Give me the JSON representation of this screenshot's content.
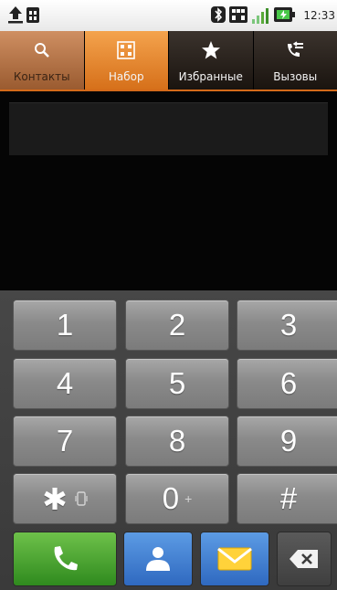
{
  "status_bar": {
    "time": "12:33"
  },
  "tabs": [
    {
      "label": "Контакты",
      "icon": "search-icon",
      "state": "pressed"
    },
    {
      "label": "Набор",
      "icon": "dialpad-icon",
      "state": "active"
    },
    {
      "label": "Избранные",
      "icon": "star-icon",
      "state": "normal"
    },
    {
      "label": "Вызовы",
      "icon": "call-log-icon",
      "state": "normal"
    }
  ],
  "display": {
    "number": ""
  },
  "keypad": {
    "keys": [
      {
        "label": "1"
      },
      {
        "label": "2"
      },
      {
        "label": "3"
      },
      {
        "label": "4"
      },
      {
        "label": "5"
      },
      {
        "label": "6"
      },
      {
        "label": "7"
      },
      {
        "label": "8"
      },
      {
        "label": "9"
      },
      {
        "label": "✱",
        "sub_icon": "vibrate-icon"
      },
      {
        "label": "0",
        "sub": "+"
      },
      {
        "label": "#"
      }
    ]
  },
  "actions": {
    "call": {
      "icon": "phone-icon",
      "color": "#3a9a26"
    },
    "contact": {
      "icon": "person-icon",
      "color": "#3a78cf"
    },
    "message": {
      "icon": "envelope-icon",
      "color": "#3a78cf"
    },
    "delete": {
      "icon": "backspace-icon",
      "color": "#4a4a4a"
    }
  },
  "colors": {
    "accent": "#e07a22",
    "display_bg": "#050505",
    "keypad_bg": "#404040"
  }
}
